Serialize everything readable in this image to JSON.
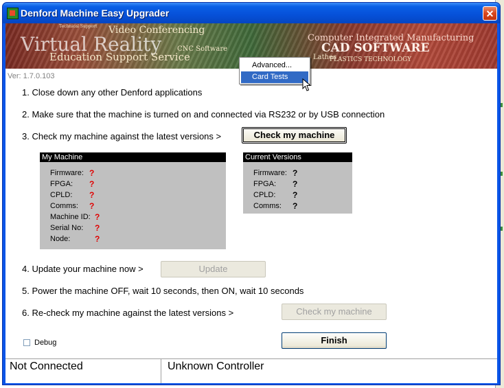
{
  "window": {
    "title": "Denford Machine Easy Upgrader",
    "close_label": "✕",
    "version": "Ver: 1.7.0.103"
  },
  "banner": {
    "texts": [
      "Video Conferencing",
      "Virtual Reality",
      "Education Support Service",
      "CNC Software",
      "Computer Integrated Manufacturing",
      "CAD SOFTWARE",
      "Lathes",
      "PLASTICS TECHNOLOGY",
      "Technical Support"
    ]
  },
  "context_menu": {
    "items": [
      {
        "label": "Advanced...",
        "highlighted": false
      },
      {
        "label": "Card Tests",
        "highlighted": true
      }
    ]
  },
  "steps": {
    "step1": "1. Close down any other Denford applications",
    "step2": "2. Make sure that the machine is turned on and connected via RS232 or by USB connection",
    "step3": "3. Check my machine against the latest versions >",
    "step4": "4. Update your machine now >",
    "step5": "5. Power the machine OFF, wait 10 seconds, then ON, wait 10 seconds",
    "step6": "6. Re-check my machine against the latest versions >"
  },
  "buttons": {
    "check": "Check my machine",
    "update": "Update",
    "recheck": "Check my machine",
    "finish": "Finish"
  },
  "my_machine": {
    "header": "My Machine",
    "rows": [
      {
        "label": "Firmware:",
        "value": "?"
      },
      {
        "label": "FPGA:",
        "value": "?"
      },
      {
        "label": "CPLD:",
        "value": "?"
      },
      {
        "label": "Comms:",
        "value": "?"
      },
      {
        "label": "Machine ID:",
        "value": "?"
      },
      {
        "label": "Serial No:",
        "value": "?"
      },
      {
        "label": "Node:",
        "value": "?"
      }
    ]
  },
  "current_versions": {
    "header": "Current Versions",
    "rows": [
      {
        "label": "Firmware:",
        "value": "?"
      },
      {
        "label": "FPGA:",
        "value": "?"
      },
      {
        "label": "CPLD:",
        "value": "?"
      },
      {
        "label": "Comms:",
        "value": "?"
      }
    ]
  },
  "debug": {
    "label": "Debug",
    "checked": false
  },
  "status": {
    "connection": "Not Connected",
    "controller": "Unknown Controller"
  },
  "colors": {
    "titlebar": "#0a55e8",
    "unknown_value_red": "#e00000",
    "menu_highlight": "#316ac5"
  }
}
